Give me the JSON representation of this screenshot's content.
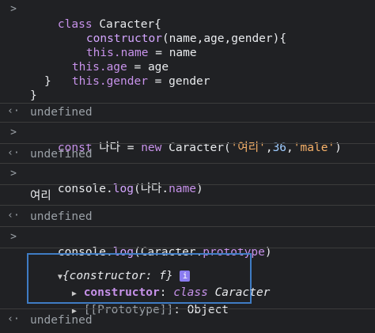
{
  "entries": {
    "e1": {
      "l1_kw": "class",
      "l1_name": "Caracter{",
      "l2_fn": "constructor",
      "l2_rest": "(name,age,gender){",
      "l3_this": "this",
      "l3_prop": ".name",
      "l3_rest": " = name",
      "l4_this": "this",
      "l4_prop": ".age",
      "l4_rest": " = age",
      "l5_this": "this",
      "l5_prop": ".gender",
      "l5_rest": " = gender",
      "l6": "}",
      "l7": "}"
    },
    "r1": "undefined",
    "e2": {
      "kw": "const",
      "var": " 나다 = ",
      "new": "new",
      "call": " Caracter(",
      "s1": "'여리'",
      "comma1": ",",
      "n1": "36",
      "comma2": ",",
      "s2": "'male'",
      "close": ")"
    },
    "r2": "undefined",
    "e3": {
      "a": "console.",
      "b": "log",
      "c": "(나다.",
      "d": "name",
      "e": ")"
    },
    "o3": "여리",
    "r3": "undefined",
    "e4": {
      "a": "console.",
      "b": "log",
      "c": "(Caracter.",
      "d": "prototype",
      "e": ")"
    },
    "o4": {
      "head": "{constructor: f}",
      "info": "i",
      "row1_key": "constructor",
      "row1_colon": ": ",
      "row1_kw": "class",
      "row1_val": " Caracter",
      "row2_key": "[[Prototype]]",
      "row2_val": ": Object"
    },
    "r4": "undefined"
  },
  "icons": {
    "input": "chevron-right-icon",
    "result": "return-arrow-icon",
    "expand": "expand-triangle-icon"
  }
}
